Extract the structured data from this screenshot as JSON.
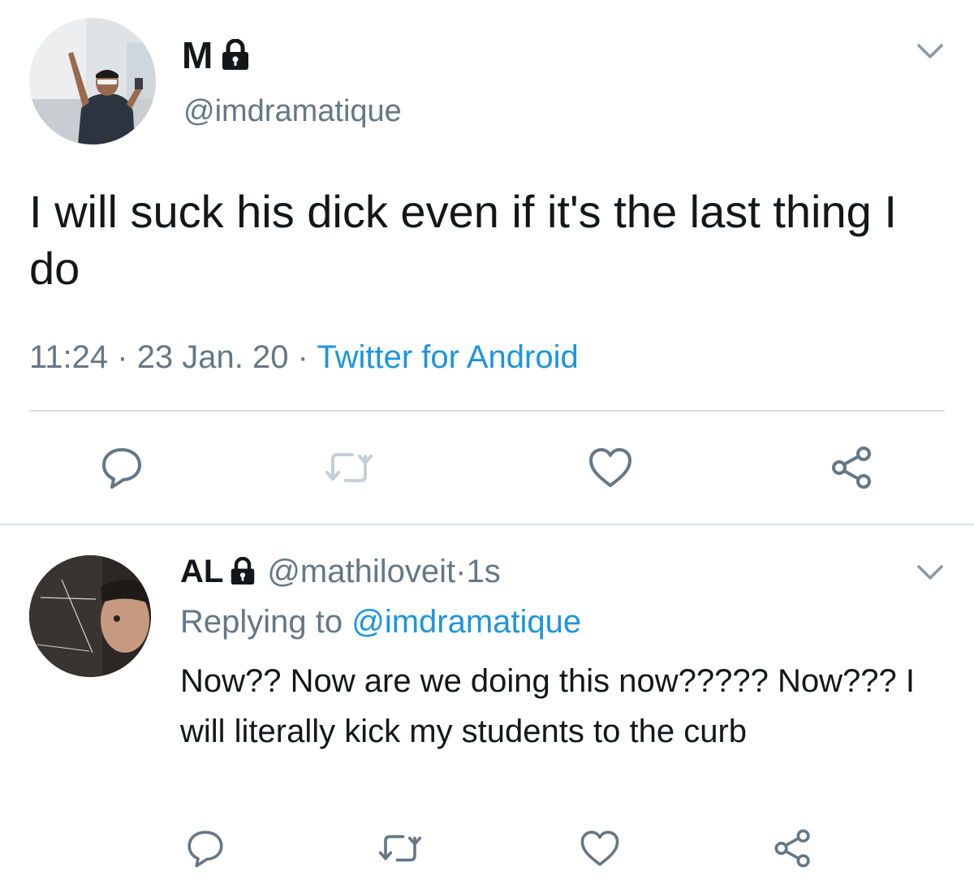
{
  "main_tweet": {
    "display_name": "M",
    "handle": "@imdramatique",
    "text": "I will suck his dick even if it's the last thing I do",
    "time": "11:24",
    "date": "23 Jan. 20",
    "separator": " · ",
    "source": "Twitter for Android",
    "icons": {
      "lock": "lock-icon",
      "chevron": "chevron-down-icon",
      "reply": "reply-icon",
      "retweet": "retweet-icon",
      "like": "heart-icon",
      "share": "share-icon"
    }
  },
  "reply_tweet": {
    "display_name": "AL",
    "handle": "@mathiloveit",
    "age_separator": " · ",
    "age": "1s",
    "replying_prefix": "Replying to ",
    "replying_to": "@imdramatique",
    "text": "Now?? Now are we doing this now????? Now??? I will literally kick my students to the curb"
  },
  "colors": {
    "text_primary": "#14171a",
    "text_secondary": "#657786",
    "link_blue": "#1b95e0",
    "divider": "#d6dee4",
    "icon_gray": "#657786"
  }
}
